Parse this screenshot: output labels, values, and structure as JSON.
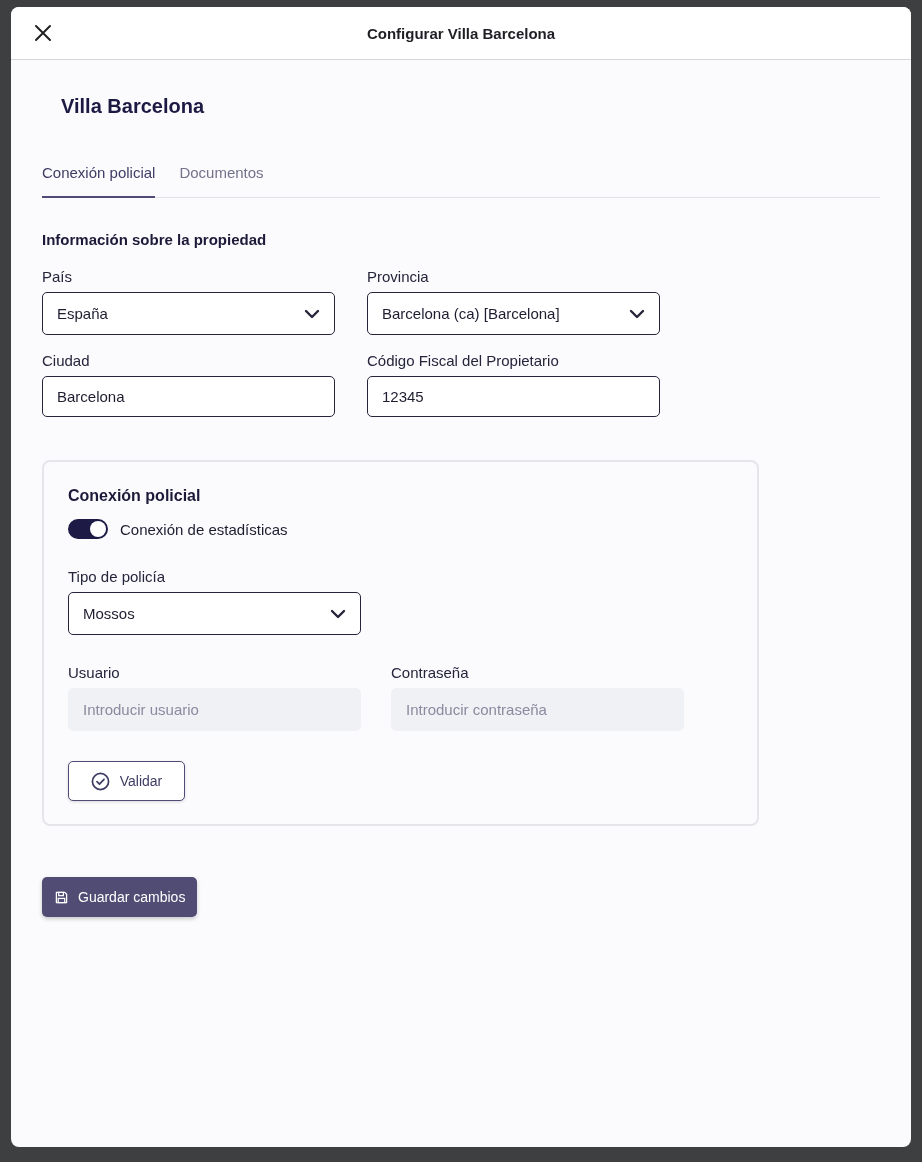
{
  "dialog": {
    "title": "Configurar Villa Barcelona"
  },
  "property_name": "Villa Barcelona",
  "tabs": [
    {
      "label": "Conexión policial",
      "selected": true
    },
    {
      "label": "Documentos",
      "selected": false
    }
  ],
  "section_title": "Información sobre la propiedad",
  "fields": [
    {
      "kind": "select",
      "label": "País",
      "value": "España"
    },
    {
      "kind": "select",
      "label": "Provincia",
      "value": "Barcelona (ca) [Barcelona]"
    },
    {
      "kind": "text",
      "label": "Ciudad",
      "value": "Barcelona"
    },
    {
      "kind": "text",
      "label": "Código Fiscal del Propietario",
      "value": "12345"
    }
  ],
  "police_card": {
    "title": "Conexión policial",
    "toggle": {
      "label": "Conexión de estadísticas",
      "on": true
    },
    "police_type": {
      "label": "Tipo de policía",
      "value": "Mossos"
    },
    "credentials": [
      {
        "label": "Usuario",
        "placeholder": "Introducir usuario"
      },
      {
        "label": "Contraseña",
        "placeholder": "Introducir contraseña"
      }
    ],
    "validate_button": "Validar"
  },
  "save_button": "Guardar cambios"
}
